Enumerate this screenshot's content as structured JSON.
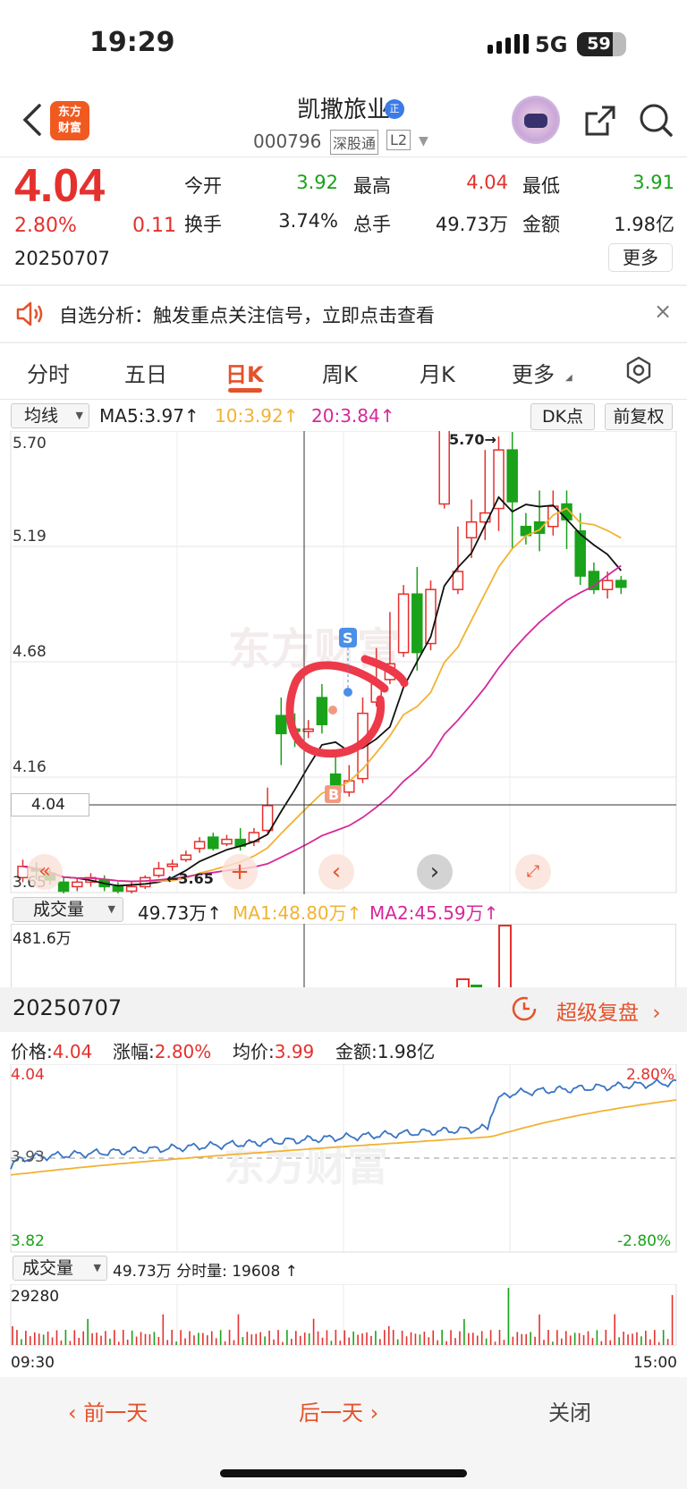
{
  "status_bar": {
    "time": "19:29",
    "network": "5G",
    "battery": "59"
  },
  "header": {
    "logo_text_1": "东方",
    "logo_text_2": "财富",
    "stock_name": "凯撒旅业",
    "badge": "正",
    "stock_code": "000796",
    "connect": "深股通",
    "level": "L2"
  },
  "quote": {
    "price": "4.04",
    "change_pct": "2.80%",
    "change_amt": "0.11",
    "date": "20250707",
    "open_label": "今开",
    "open": "3.92",
    "high_label": "最高",
    "high": "4.04",
    "low_label": "最低",
    "low": "3.91",
    "turnover_label": "换手",
    "turnover": "3.74%",
    "volume_label": "总手",
    "volume": "49.73万",
    "amount_label": "金额",
    "amount": "1.98亿",
    "more_label": "更多"
  },
  "banner": {
    "text": "自选分析：触发重点关注信号，立即点击查看",
    "close": "×"
  },
  "tabs": [
    {
      "label": "分时"
    },
    {
      "label": "五日"
    },
    {
      "label": "日K"
    },
    {
      "label": "周K"
    },
    {
      "label": "月K"
    },
    {
      "label": "更多"
    }
  ],
  "kline": {
    "ma_selector": "均线",
    "ma5": "MA5:3.97↑",
    "ma10": "10:3.92↑",
    "ma20": "20:3.84↑",
    "dk_button": "DK点",
    "adjust_button": "前复权",
    "y_ticks": [
      "5.70",
      "5.19",
      "4.68",
      "4.16",
      "3.65"
    ],
    "crosshair_price": "4.04",
    "high_marker": "5.70→",
    "low_marker": "←3.65",
    "buy_marker": "B",
    "sell_marker": "S",
    "colors": {
      "up": "#e4312e",
      "down": "#1aa21a",
      "ma5": "#111111",
      "ma10": "#f2b233",
      "ma20": "#d6289a"
    }
  },
  "volume_panel": {
    "selector": "成交量",
    "value": "49.73万↑",
    "ma1": "MA1:48.80万↑",
    "ma2": "MA2:45.59万↑",
    "max": "481.6万"
  },
  "intraday": {
    "date": "20250707",
    "replay_label": "超级复盘",
    "price_label": "价格:",
    "price": "4.04",
    "pct_label": "涨幅:",
    "pct": "2.80%",
    "avg_label": "均价:",
    "avg": "3.99",
    "amount_label": "金额:",
    "amount": "1.98亿",
    "y_top": "4.04",
    "y_mid": "3.93",
    "y_bottom": "3.82",
    "pct_top": "2.80%",
    "pct_bottom": "-2.80%",
    "vol_selector": "成交量",
    "vol_info": "49.73万 分时量: 19608 ↑",
    "vol_max": "29280",
    "time_start": "09:30",
    "time_end": "15:00"
  },
  "footer": {
    "prev": "前一天",
    "next": "后一天",
    "close": "关闭"
  }
}
